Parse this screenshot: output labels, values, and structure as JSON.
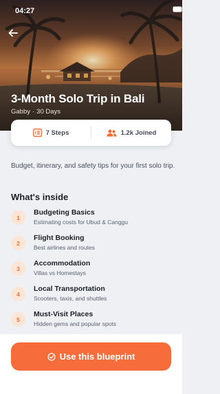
{
  "status_bar": {
    "time": "04:27"
  },
  "hero": {
    "title": "3-Month Solo Trip in Bali",
    "author": "Gabby",
    "separator": "·",
    "duration": "30 Days"
  },
  "stats": {
    "steps_label": "7 Steps",
    "joined_label": "1.2k Joined"
  },
  "description": "Budget, itinerary, and safety tips for your first solo trip.",
  "section_title": "What's inside",
  "items": [
    {
      "number": "1",
      "title": "Budgeting Basics",
      "subtitle": "Estimating costs for Ubud & Canggu"
    },
    {
      "number": "2",
      "title": "Flight Booking",
      "subtitle": "Best airlines and routes"
    },
    {
      "number": "3",
      "title": "Accommodation",
      "subtitle": "Villas vs Homestays"
    },
    {
      "number": "4",
      "title": "Local Transportation",
      "subtitle": "Scooters, taxis, and shuttles"
    },
    {
      "number": "5",
      "title": "Must-Visit Places",
      "subtitle": "Hidden gems and popular spots"
    }
  ],
  "cta": {
    "label": "Use this blueprint"
  },
  "colors": {
    "accent": "#f66d3b",
    "badge_bg": "#fde5d6",
    "page_bg": "#eef0f4"
  },
  "icons": {
    "back": "arrow-left-icon",
    "steps": "list-icon",
    "joined": "users-icon",
    "cta": "check-circle-icon"
  }
}
